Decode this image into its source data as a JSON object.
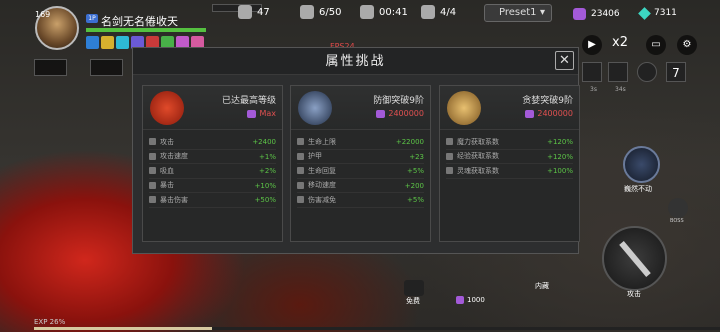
{
  "player": {
    "level": "169",
    "tag": "1P",
    "name": "名剑无名倦收天"
  },
  "top_stats": {
    "kills": "47",
    "wave": "6/50",
    "timer": "00:41",
    "stage": "4/4",
    "preset": "Preset1",
    "currency_purple": "23406",
    "currency_teal": "7311"
  },
  "controls": {
    "speed": "x2",
    "fps": "FPS24"
  },
  "modal": {
    "title": "属性挑战",
    "close_label": "✕",
    "cards": [
      {
        "title": "已达最高等级",
        "cost": "Max",
        "rows": [
          {
            "label": "攻击",
            "value": "+2400"
          },
          {
            "label": "攻击速度",
            "value": "+1%"
          },
          {
            "label": "吸血",
            "value": "+2%"
          },
          {
            "label": "暴击",
            "value": "+10%"
          },
          {
            "label": "暴击伤害",
            "value": "+50%"
          }
        ]
      },
      {
        "title": "防御突破9阶",
        "cost": "2400000",
        "rows": [
          {
            "label": "生命上限",
            "value": "+22000"
          },
          {
            "label": "护甲",
            "value": "+23"
          },
          {
            "label": "生命回复",
            "value": "+5%"
          },
          {
            "label": "移动速度",
            "value": "+200"
          },
          {
            "label": "伤害减免",
            "value": "+5%"
          }
        ]
      },
      {
        "title": "贪婪突破9阶",
        "cost": "2400000",
        "rows": [
          {
            "label": "魔力获取系数",
            "value": "+120%"
          },
          {
            "label": "经验获取系数",
            "value": "+120%"
          },
          {
            "label": "灵魂获取系数",
            "value": "+100%"
          }
        ]
      }
    ]
  },
  "right_panel": {
    "skill_label": "巍然不动",
    "boss_label": "BOSS",
    "attack_label": "攻击",
    "cooldown_1": "3s",
    "cooldown_2": "34s"
  },
  "bottom": {
    "free_label": "免费",
    "cost_value": "1000",
    "hidden_label": "内藏",
    "exp_label": "EXP 26%",
    "exp_progress": 0.26
  },
  "colors": {
    "accent_green": "#5cc447",
    "cost_red": "#e05050",
    "gem_purple": "#a35ad8"
  }
}
